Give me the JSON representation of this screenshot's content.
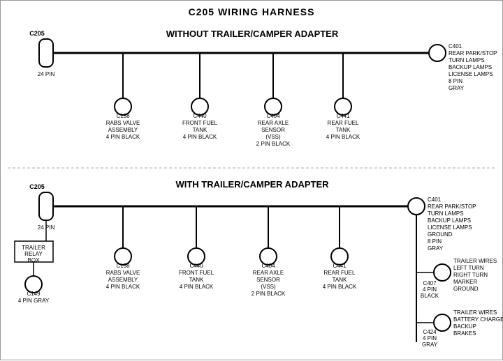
{
  "title": "C205 WIRING HARNESS",
  "top_section": {
    "label": "WITHOUT TRAILER/CAMPER ADAPTER",
    "left_connector": {
      "id": "C205",
      "pins": "24 PIN"
    },
    "right_connector": {
      "id": "C401",
      "pins": "8 PIN",
      "color": "GRAY",
      "desc": "REAR PARK/STOP\nTURN LAMPS\nBACKUP LAMPS\nLICENSE LAMPS"
    },
    "connectors": [
      {
        "id": "C158",
        "desc": "RABS VALVE\nASSEMBLY\n4 PIN BLACK"
      },
      {
        "id": "C440",
        "desc": "FRONT FUEL\nTANK\n4 PIN BLACK"
      },
      {
        "id": "C404",
        "desc": "REAR AXLE\nSENSOR\n(VSS)\n2 PIN BLACK"
      },
      {
        "id": "C441",
        "desc": "REAR FUEL\nTANK\n4 PIN BLACK"
      }
    ]
  },
  "bottom_section": {
    "label": "WITH TRAILER/CAMPER ADAPTER",
    "left_connector": {
      "id": "C205",
      "pins": "24 PIN"
    },
    "right_connector": {
      "id": "C401",
      "pins": "8 PIN",
      "color": "GRAY",
      "desc": "REAR PARK/STOP\nTURN LAMPS\nBACKUP LAMPS\nLICENSE LAMPS\nGROUND"
    },
    "extra_left": {
      "box_label": "TRAILER\nRELAY\nBOX",
      "connector": {
        "id": "C149",
        "pins": "4 PIN GRAY"
      }
    },
    "connectors": [
      {
        "id": "C158",
        "desc": "RABS VALVE\nASSEMBLY\n4 PIN BLACK"
      },
      {
        "id": "C440",
        "desc": "FRONT FUEL\nTANK\n4 PIN BLACK"
      },
      {
        "id": "C404",
        "desc": "REAR AXLE\nSENSOR\n(VSS)\n2 PIN BLACK"
      },
      {
        "id": "C441",
        "desc": "REAR FUEL\nTANK\n4 PIN BLACK"
      }
    ],
    "right_extra": [
      {
        "id": "C407",
        "pins": "4 PIN",
        "color": "BLACK",
        "desc": "TRAILER WIRES\nLEFT TURN\nRIGHT TURN\nMARKER\nGROUND"
      },
      {
        "id": "C424",
        "pins": "4 PIN",
        "color": "GRAY",
        "desc": "TRAILER WIRES\nBATTERY CHARGE\nBACKUP\nBRAKES"
      }
    ]
  }
}
